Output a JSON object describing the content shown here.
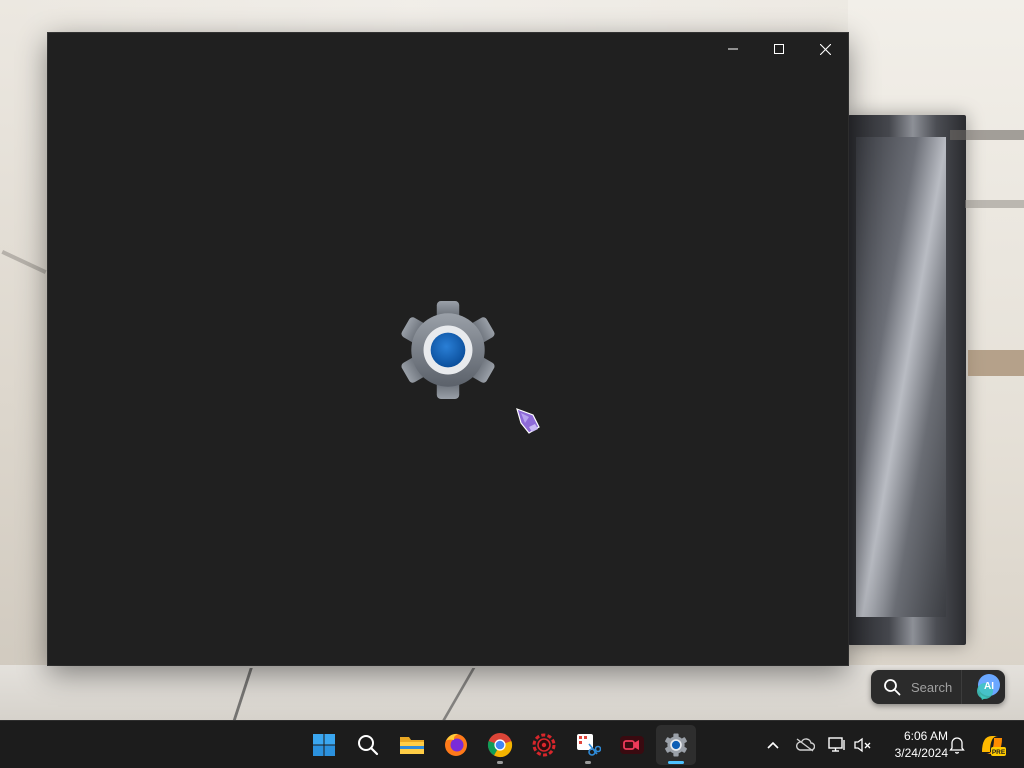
{
  "desktop": {
    "search_widget": {
      "placeholder": "Search",
      "ai_badge": "AI"
    }
  },
  "window": {
    "title": "Settings",
    "controls": [
      "minimize",
      "maximize",
      "close"
    ],
    "splash_icon": "settings-gear-icon"
  },
  "taskbar": {
    "apps": [
      {
        "name": "Start",
        "icon": "windows-start-icon"
      },
      {
        "name": "Search",
        "icon": "search-icon"
      },
      {
        "name": "File Explorer",
        "icon": "folder-icon"
      },
      {
        "name": "Firefox",
        "icon": "firefox-icon"
      },
      {
        "name": "Chrome",
        "icon": "chrome-icon",
        "running": true
      },
      {
        "name": "Recorder",
        "icon": "red-gear-icon"
      },
      {
        "name": "Snipping Tool",
        "icon": "snipping-tool-icon",
        "running": true
      },
      {
        "name": "Screen Recorder",
        "icon": "camera-recorder-icon"
      },
      {
        "name": "Settings",
        "icon": "settings-gear-icon",
        "active": true
      }
    ],
    "tray": {
      "overflow_icon": "chevron-up-icon",
      "onedrive_icon": "cloud-offline-icon",
      "network_icon": "network-icon",
      "volume_icon": "volume-muted-icon",
      "notification_icon": "bell-icon",
      "copilot_badge": "PRE"
    },
    "clock": {
      "time": "6:06 AM",
      "date": "3/24/2024"
    }
  },
  "colors": {
    "window_bg": "#202020",
    "taskbar_bg": "#1c1c1c",
    "accent": "#4cc2ff",
    "gear_blue": "#0f5fb5"
  }
}
